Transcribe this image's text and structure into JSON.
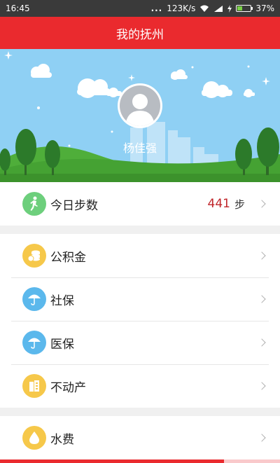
{
  "status_bar": {
    "time": "16:45",
    "dots": "...",
    "speed": "123K/s",
    "battery_percent": "37%",
    "battery_level": 0.37
  },
  "title": "我的抚州",
  "profile": {
    "name": "杨佳强"
  },
  "steps": {
    "label": "今日步数",
    "value": "441",
    "unit": "步"
  },
  "menu_group_1": [
    {
      "label": "公积金",
      "icon": "coins-icon",
      "color": "#f6c84a"
    },
    {
      "label": "社保",
      "icon": "umbrella-icon",
      "color": "#5bb8ec"
    },
    {
      "label": "医保",
      "icon": "umbrella-icon",
      "color": "#5bb8ec"
    },
    {
      "label": "不动产",
      "icon": "building-icon",
      "color": "#f6c84a"
    }
  ],
  "menu_group_2": [
    {
      "label": "水费",
      "icon": "water-drop-icon",
      "color": "#f6c84a"
    }
  ],
  "colors": {
    "brand": "#ea2a2e",
    "steps_icon": "#6dcf7c",
    "steps_value": "#c0252a"
  }
}
